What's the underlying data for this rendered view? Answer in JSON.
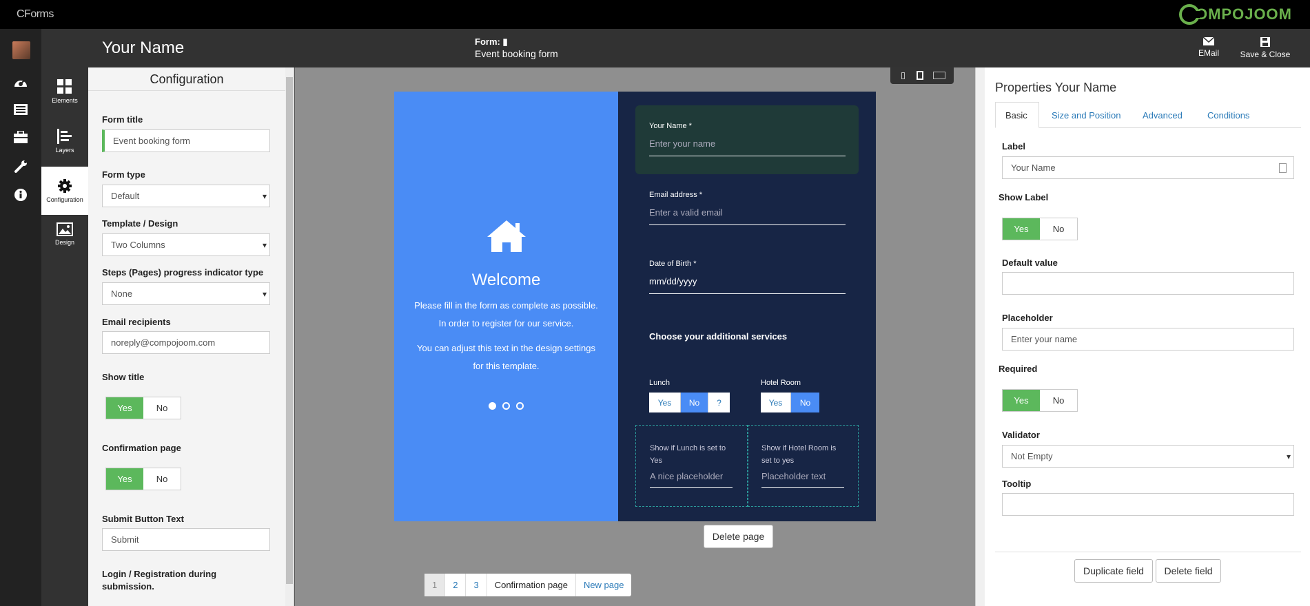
{
  "app": {
    "brand": "CForms",
    "logo_text": "OMPOJOOM"
  },
  "header": {
    "element_name": "Your Name",
    "form_label": "Form:",
    "form_name": "Event booking form",
    "email_label": "EMail",
    "save_close_label": "Save & Close"
  },
  "tabs": [
    {
      "label": "Elements",
      "icon": "grid-icon"
    },
    {
      "label": "Layers",
      "icon": "layers-icon"
    },
    {
      "label": "Configuration",
      "icon": "gear-icon"
    },
    {
      "label": "Design",
      "icon": "image-icon"
    }
  ],
  "config": {
    "title": "Configuration",
    "form_title_label": "Form title",
    "form_title_value": "Event booking form",
    "form_type_label": "Form type",
    "form_type_value": "Default",
    "template_label": "Template / Design",
    "template_value": "Two Columns",
    "steps_label": "Steps (Pages) progress indicator type",
    "steps_value": "None",
    "email_label": "Email recipients",
    "email_value": "noreply@compojoom.com",
    "show_title_label": "Show title",
    "confirmation_label": "Confirmation page",
    "submit_label": "Submit Button Text",
    "submit_value": "Submit",
    "login_label": "Login / Registration during submission.",
    "yes": "Yes",
    "no": "No"
  },
  "canvas": {
    "welcome_title": "Welcome",
    "welcome_line1": "Please fill in the form as complete as possible.",
    "welcome_line2": "In order to register for our service.",
    "welcome_line3": "You can adjust this text in the design settings",
    "welcome_line4": "for this template.",
    "name_label": "Your Name *",
    "name_placeholder": "Enter your name",
    "email_label": "Email address *",
    "email_placeholder": "Enter a valid email",
    "dob_label": "Date of Birth *",
    "dob_placeholder": "mm/dd/yyyy",
    "services_heading": "Choose your additional services",
    "lunch_label": "Lunch",
    "lunch_yes": "Yes",
    "lunch_no": "No",
    "lunch_q": "?",
    "hotel_label": "Hotel Room",
    "hotel_yes": "Yes",
    "hotel_no": "No",
    "cond1_label": "Show if Lunch is set to Yes",
    "cond1_placeholder": "A nice placeholder",
    "cond2_label": "Show if Hotel Room is set to yes",
    "cond2_placeholder": "Placeholder text",
    "delete_page": "Delete page"
  },
  "pager": {
    "pages": [
      "1",
      "2",
      "3"
    ],
    "confirmation": "Confirmation page",
    "new_page": "New page"
  },
  "properties": {
    "title": "Properties Your Name",
    "tabs": [
      "Basic",
      "Size and Position",
      "Advanced",
      "Conditions"
    ],
    "label_label": "Label",
    "label_value": "Your Name",
    "show_label_label": "Show Label",
    "default_label": "Default value",
    "default_value": "",
    "placeholder_label": "Placeholder",
    "placeholder_value": "Enter your name",
    "required_label": "Required",
    "validator_label": "Validator",
    "validator_value": "Not Empty",
    "tooltip_label": "Tooltip",
    "tooltip_value": "",
    "yes": "Yes",
    "no": "No",
    "duplicate": "Duplicate field",
    "delete": "Delete field"
  },
  "colors": {
    "accent_green": "#5cb85c",
    "left_column": "#4a8cf5",
    "right_column": "#172545",
    "link": "#2a7ab8"
  }
}
